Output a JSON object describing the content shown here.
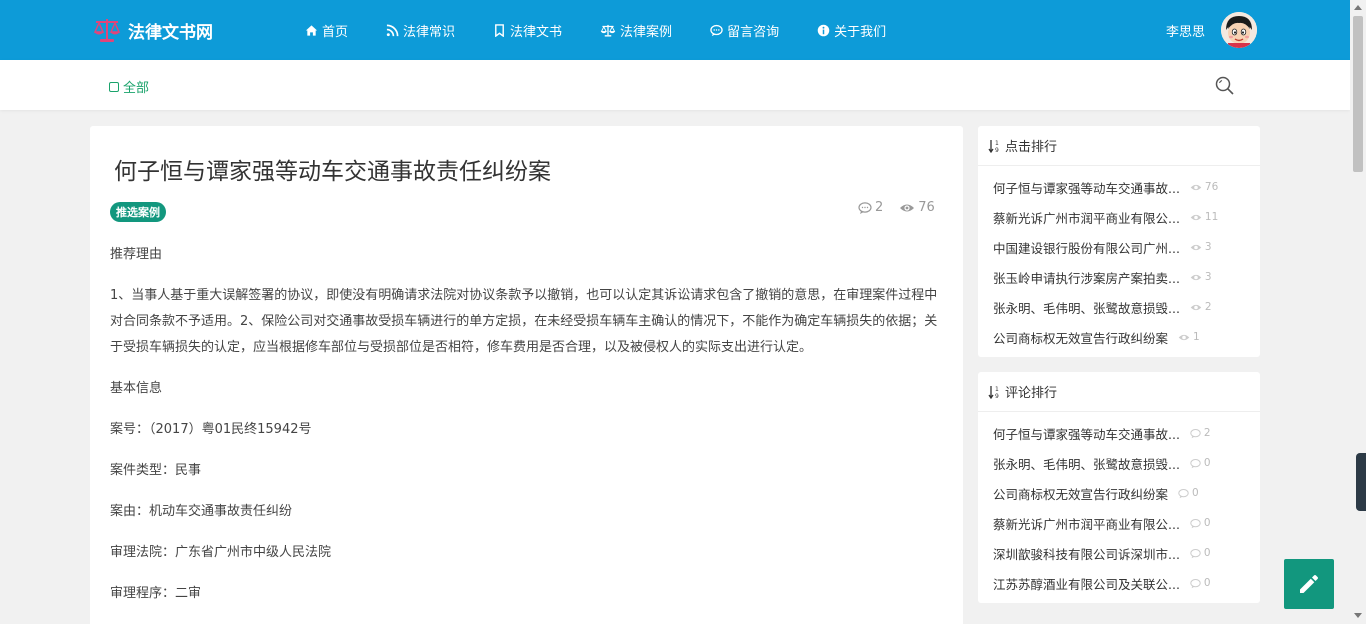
{
  "brand": {
    "name": "法律文书网"
  },
  "nav": [
    {
      "label": "首页",
      "icon": "home-icon"
    },
    {
      "label": "法律常识",
      "icon": "rss-icon"
    },
    {
      "label": "法律文书",
      "icon": "bookmark-icon"
    },
    {
      "label": "法律案例",
      "icon": "scale-icon"
    },
    {
      "label": "留言咨询",
      "icon": "comment-icon"
    },
    {
      "label": "关于我们",
      "icon": "info-icon"
    }
  ],
  "user": {
    "name": "李思思"
  },
  "subnav": {
    "all_label": "全部"
  },
  "article": {
    "title": "何子恒与谭家强等动车交通事故责任纠纷案",
    "tag": "推选案例",
    "comments": "2",
    "views": "76",
    "paragraphs": [
      "推荐理由",
      "1、当事人基于重大误解签署的协议，即使没有明确请求法院对协议条款予以撤销，也可以认定其诉讼请求包含了撤销的意思，在审理案件过程中对合同条款不予适用。2、保险公司对交通事故受损车辆进行的单方定损，在未经受损车辆车主确认的情况下，不能作为确定车辆损失的依据；关于受损车辆损失的认定，应当根据修车部位与受损部位是否相符，修车费用是否合理，以及被侵权人的实际支出进行认定。",
      "基本信息",
      "案号：（2017）粤01民终15942号",
      "案件类型：民事",
      "案由：机动车交通事故责任纠纷",
      "审理法院：广东省广州市中级人民法院",
      "审理程序：二审"
    ]
  },
  "click_rank": {
    "title": "点击排行",
    "items": [
      {
        "title": "何子恒与谭家强等动车交通事故...",
        "count": "76"
      },
      {
        "title": "蔡新光诉广州市润平商业有限公...",
        "count": "11"
      },
      {
        "title": "中国建设银行股份有限公司广州...",
        "count": "3"
      },
      {
        "title": "张玉岭申请执行涉案房产案拍卖...",
        "count": "3"
      },
      {
        "title": "张永明、毛伟明、张鹭故意损毁...",
        "count": "2"
      },
      {
        "title": "公司商标权无效宣告行政纠纷案",
        "count": "1"
      }
    ]
  },
  "comment_rank": {
    "title": "评论排行",
    "items": [
      {
        "title": "何子恒与谭家强等动车交通事故...",
        "count": "2"
      },
      {
        "title": "张永明、毛伟明、张鹭故意损毁...",
        "count": "0"
      },
      {
        "title": "公司商标权无效宣告行政纠纷案",
        "count": "0"
      },
      {
        "title": "蔡新光诉广州市润平商业有限公...",
        "count": "0"
      },
      {
        "title": "深圳歆骏科技有限公司诉深圳市...",
        "count": "0"
      },
      {
        "title": "江苏苏醇酒业有限公司及关联公...",
        "count": "0"
      }
    ]
  },
  "colors": {
    "header": "#0d9bd8",
    "accent": "#12977e",
    "link_green": "#1aa36b"
  }
}
